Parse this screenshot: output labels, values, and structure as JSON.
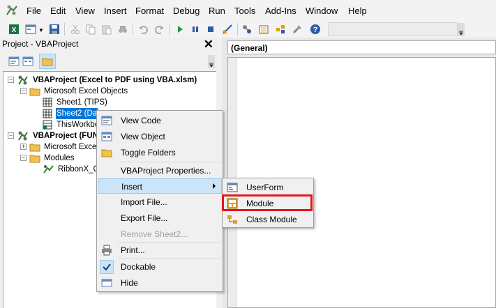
{
  "menubar": {
    "items": [
      "File",
      "Edit",
      "View",
      "Insert",
      "Format",
      "Debug",
      "Run",
      "Tools",
      "Add-Ins",
      "Window",
      "Help"
    ]
  },
  "project_pane": {
    "title": "Project - VBAProject",
    "close_glyph": "✕"
  },
  "tree": {
    "project1_name": "VBAProject (Excel to PDF using VBA.xlsm)",
    "folder_objects": "Microsoft Excel Objects",
    "sheet1": "Sheet1 (TIPS)",
    "sheet2_visible": "Sheet2 (Da",
    "thisworkbook_visible": "ThisWorkbo",
    "project2_visible": "VBAProject (FUN",
    "folder_objects2_visible": "Microsoft Excel",
    "folder_modules": "Modules",
    "ribbonx_visible": "RibbonX_Co"
  },
  "code_window": {
    "object_combo": "(General)"
  },
  "context_menu": {
    "items": [
      {
        "label": "View Code",
        "icon": "view-code-icon"
      },
      {
        "label": "View Object",
        "icon": "view-object-icon"
      },
      {
        "label": "Toggle Folders",
        "icon": "folder-icon"
      },
      {
        "label": "VBAProject Properties...",
        "icon": ""
      },
      {
        "label": "Insert",
        "icon": "",
        "submenu": true,
        "highlighted": true
      },
      {
        "label": "Import File...",
        "icon": ""
      },
      {
        "label": "Export File...",
        "icon": ""
      },
      {
        "label": "Remove Sheet2...",
        "icon": "",
        "disabled": true
      },
      {
        "label": "Print...",
        "icon": "printer-icon"
      },
      {
        "label": "Dockable",
        "icon": "checkmark-icon",
        "checked": true
      },
      {
        "label": "Hide",
        "icon": "hide-icon"
      }
    ]
  },
  "submenu": {
    "items": [
      {
        "label": "UserForm",
        "icon": "userform-icon"
      },
      {
        "label": "Module",
        "icon": "module-icon"
      },
      {
        "label": "Class Module",
        "icon": "class-module-icon"
      }
    ]
  },
  "colors": {
    "selection_blue": "#0078d7",
    "menu_highlight": "#cce4f7",
    "callout_red": "#e3161d"
  }
}
